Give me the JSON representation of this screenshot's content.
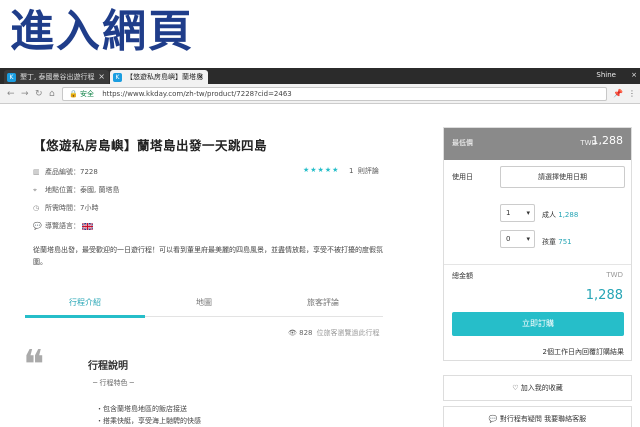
{
  "heading": "進入網頁",
  "browser": {
    "tabs": [
      {
        "label": "墾丁, 泰國曼谷出遊行程"
      },
      {
        "label": "【悠遊私房島嶼】蘭塔島"
      }
    ],
    "profile": "Shine",
    "address": {
      "secure_label": "安全",
      "url": "https://www.kkday.com/zh-tw/product/7228?cid=2463"
    }
  },
  "product": {
    "title": "【悠遊私房島嶼】蘭塔島出發一天跳四島",
    "code_label": "產品編號：",
    "code": "7228",
    "location_label": "地點位置：",
    "location": "泰國, 蘭塔島",
    "duration_label": "所需時間：",
    "duration": "7小時",
    "language_label": "導覽語言：",
    "stars": "★★★★★",
    "review_count": "1",
    "review_label": "則評論",
    "description": "從蘭塔島出發，最受歡迎的一日遊行程！可以看到董里府最美麗的四島風景，並盡情放鬆，享受不被打擾的度假氛圍。",
    "tabs": [
      "行程介紹",
      "地圖",
      "旅客評論"
    ],
    "views": "828",
    "views_label": "位旅客瀏覽過此行程",
    "section_title": "行程說明",
    "section_sub": "─ 行程特色 ─",
    "bullets": [
      "・包含蘭塔島地區的飯店接送",
      "・搭乘快艇，享受海上馳騁的快感"
    ]
  },
  "booking": {
    "lowest_label": "最低價",
    "currency": "TWD",
    "lowest_price": "1,288",
    "date_label": "使用日",
    "date_button": "請選擇使用日期",
    "adult_qty": "1",
    "adult_label": "成人",
    "adult_price": "1,288",
    "child_qty": "0",
    "child_label": "孩童",
    "child_price": "751",
    "total_label": "總金額",
    "total_currency": "TWD",
    "total_price": "1,288",
    "book_button": "立即訂購",
    "confirm_note": "2個工作日內回覆訂購結果",
    "wishlist_button": "加入我的收藏",
    "contact_button": "對行程有疑問 我要聯絡客服"
  }
}
